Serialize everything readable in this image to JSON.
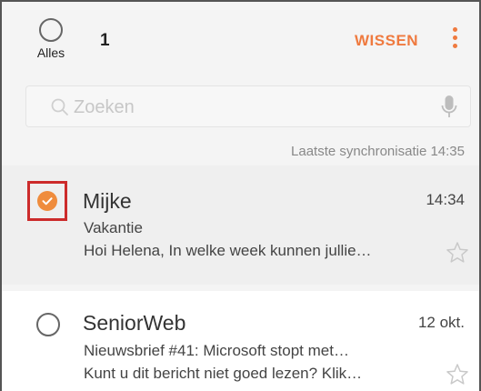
{
  "header": {
    "select_all_label": "Alles",
    "selected_count": "1",
    "clear_label": "WISSEN",
    "menu_icon": "more-vertical-icon"
  },
  "search": {
    "placeholder": "Zoeken",
    "search_icon": "search-icon",
    "mic_icon": "microphone-icon"
  },
  "sync_status": "Laatste synchronisatie 14:35",
  "messages": [
    {
      "sender": "Mijke",
      "time": "14:34",
      "subject": "Vakantie",
      "preview": "Hoi Helena, In welke week kunnen jullie…",
      "selected": true
    },
    {
      "sender": "SeniorWeb",
      "time": "12 okt.",
      "subject": "Nieuwsbrief #41: Microsoft stopt met…",
      "preview": "Kunt u dit bericht niet goed lezen? Klik…",
      "selected": false
    }
  ],
  "colors": {
    "accent": "#ef7a3f",
    "check": "#ef8c3d",
    "highlight_box": "#cc2b2b",
    "selected_row_bg": "#efefef"
  }
}
